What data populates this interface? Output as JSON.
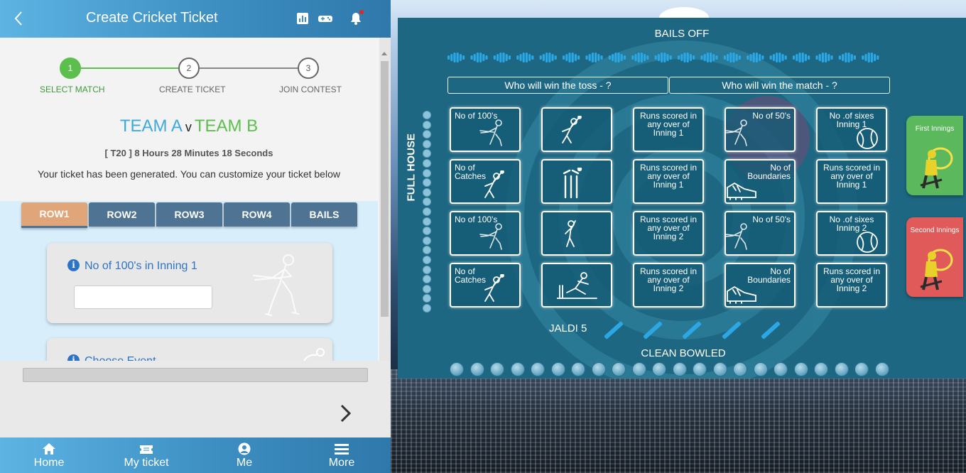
{
  "header": {
    "title": "Create Cricket Ticket",
    "icons": [
      "back-icon",
      "chart-icon",
      "gamepad-icon",
      "bell-icon"
    ]
  },
  "stepper": {
    "steps": [
      {
        "number": "1",
        "label": "SELECT MATCH",
        "state": "active"
      },
      {
        "number": "2",
        "label": "CREATE TICKET",
        "state": "pending"
      },
      {
        "number": "3",
        "label": "JOIN CONTEST",
        "state": "pending"
      }
    ]
  },
  "match": {
    "team_a": "TEAM A",
    "vs": "v",
    "team_b": "TEAM B",
    "countdown": "[ T20 ] 8 Hours 28 Minutes 18 Seconds",
    "message": "Your ticket has been generated. You can customize your ticket below"
  },
  "tabs": [
    "ROW1",
    "ROW2",
    "ROW3",
    "ROW4",
    "BAILS"
  ],
  "active_tab": "ROW1",
  "questions": [
    {
      "label": "No of 100's in Inning 1",
      "value": ""
    },
    {
      "label": "Choose Event"
    }
  ],
  "bottom_nav": [
    {
      "label": "Home",
      "icon": "home-icon"
    },
    {
      "label": "My ticket",
      "icon": "ticket-icon"
    },
    {
      "label": "Me",
      "icon": "user-icon"
    },
    {
      "label": "More",
      "icon": "menu-icon"
    }
  ],
  "colors": {
    "header": "#3d8fc2",
    "team_a": "#3ea9dd",
    "team_b": "#5cbf4d",
    "step_active": "#5cbf4d",
    "tab_active": "#e0a679",
    "tab": "#4f7393",
    "board": "#1e6782"
  },
  "board": {
    "bails_off": "BAILS OFF",
    "prediction_toss": "Who will win the toss - ?",
    "prediction_match": "Who will win the match - ?",
    "full_house": "FULL HOUSE",
    "jaldi": "JALDI 5",
    "clean_bowled": "CLEAN BOWLED",
    "grid": [
      [
        {
          "text": "No of 100's",
          "icon": "batsman-icon",
          "align": "left"
        },
        {
          "text": "",
          "icon": "fielder-catch-icon"
        },
        {
          "text": "Runs scored in any over of Inning 1",
          "icon": "",
          "align": "center"
        },
        {
          "text": "No of 50's",
          "icon": "batsman-icon",
          "align": "right"
        },
        {
          "text": "No .of sixes Inning 1",
          "icon": "cricket-ball-icon",
          "align": "center"
        }
      ],
      [
        {
          "text": "No of Catches",
          "icon": "fielder-catch-icon",
          "align": "left"
        },
        {
          "text": "",
          "icon": "stumps-icon"
        },
        {
          "text": "Runs scored in any over of Inning 1",
          "icon": "",
          "align": "center"
        },
        {
          "text": "No of Boundaries",
          "icon": "shoe-icon",
          "align": "right"
        },
        {
          "text": "Runs scored in any over of Inning 1",
          "icon": "",
          "align": "center"
        }
      ],
      [
        {
          "text": "No of 100's",
          "icon": "batsman-icon",
          "align": "left"
        },
        {
          "text": "",
          "icon": "batsman-stance-icon"
        },
        {
          "text": "Runs scored in any over of Inning 2",
          "icon": "",
          "align": "center"
        },
        {
          "text": "No of 50's",
          "icon": "batsman-icon",
          "align": "right"
        },
        {
          "text": "No .of sixes Inning 2",
          "icon": "cricket-ball-icon",
          "align": "center"
        }
      ],
      [
        {
          "text": "No of Catches",
          "icon": "fielder-catch-icon",
          "align": "left"
        },
        {
          "text": "",
          "icon": "bowled-icon"
        },
        {
          "text": "Runs scored in any over of Inning 2",
          "icon": "",
          "align": "center"
        },
        {
          "text": "No of Boundaries",
          "icon": "shoe-icon",
          "align": "right"
        },
        {
          "text": "Runs scored in any over of Inning 2",
          "icon": "",
          "align": "center"
        }
      ]
    ],
    "innings_cards": [
      {
        "label": "First Innings",
        "color": "#5cb85c"
      },
      {
        "label": "Second Innings",
        "color": "#e05a5a"
      }
    ]
  }
}
